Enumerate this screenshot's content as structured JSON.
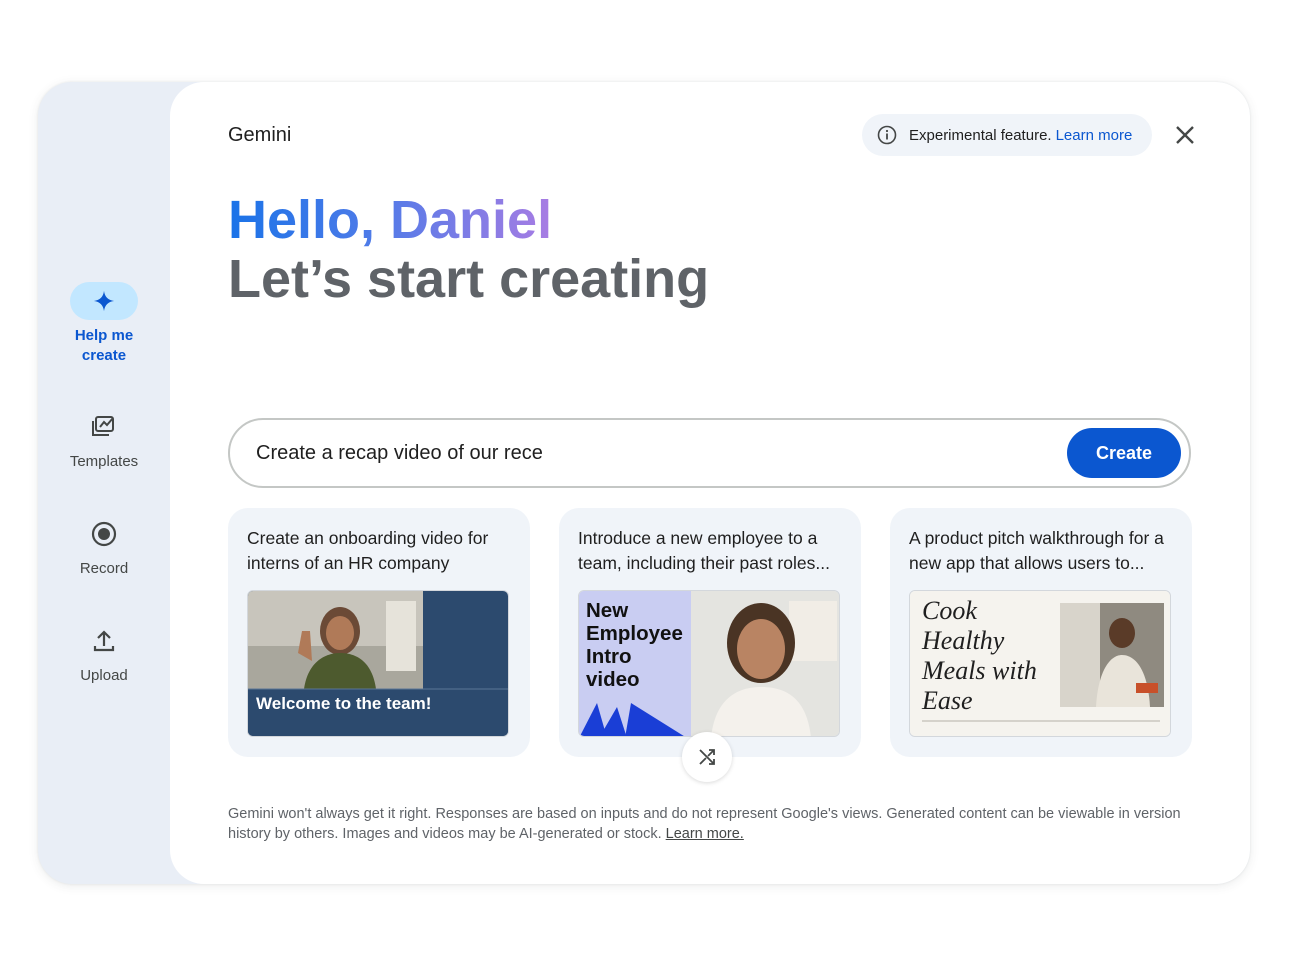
{
  "sidebar": {
    "items": [
      {
        "label_line1": "Help me",
        "label_line2": "create",
        "icon": "sparkle-icon",
        "active": true
      },
      {
        "label": "Templates",
        "icon": "templates-icon"
      },
      {
        "label": "Record",
        "icon": "record-icon"
      },
      {
        "label": "Upload",
        "icon": "upload-icon"
      }
    ]
  },
  "header": {
    "brand": "Gemini",
    "notice_text": "Experimental feature.",
    "notice_link": "Learn more"
  },
  "hero": {
    "greeting": "Hello, Daniel",
    "subtitle": "Let’s start creating"
  },
  "prompt": {
    "value": "Create a recap video of our rece",
    "create_label": "Create"
  },
  "suggestions": [
    {
      "text": "Create an onboarding video for interns of an HR company",
      "thumb_caption": "Welcome to the team!"
    },
    {
      "text": "Introduce a new employee to a team, including their past roles...",
      "thumb_caption": "New Employee Intro video"
    },
    {
      "text": "A product pitch walkthrough for a new app that allows users to...",
      "thumb_caption": "Cook Healthy Meals with Ease"
    }
  ],
  "disclaimer": {
    "text": "Gemini won't always get it right. Responses are based on inputs and do not represent Google's views. Generated content can be viewable in version history by others. Images and videos may be AI-generated or stock.",
    "link": "Learn more."
  },
  "colors": {
    "accent": "#0b57d0",
    "active_pill": "#c2e7ff",
    "sidebar_bg": "#e9eef6",
    "card_bg": "#f0f4f9"
  }
}
